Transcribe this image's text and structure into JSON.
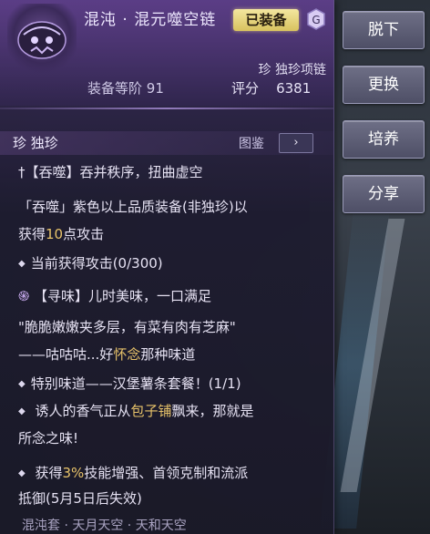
{
  "item": {
    "name": "混沌 · 混元噬空链",
    "status_badge": "已装备",
    "subtype": "珍 独珍项链",
    "level_label": "装备等阶",
    "level_value": "91",
    "score_label": "评分",
    "score_value": "6381"
  },
  "quality": {
    "label": "珍 独珍",
    "codex_label": "图鉴",
    "codex_button": "›"
  },
  "effects": [
    {
      "id": "e1",
      "text": "†【吞噬】吞并秩序，扭曲虚空"
    },
    {
      "id": "e2",
      "text": "「吞噬」紫色以上品质装备(非独珍)以"
    },
    {
      "id": "e3a",
      "text": "获得"
    },
    {
      "id": "e3b",
      "text": "10"
    },
    {
      "id": "e3c",
      "text": "点攻击"
    },
    {
      "id": "e4",
      "text": "当前获得攻击(0/300)"
    },
    {
      "id": "e5",
      "text": "【寻味】儿时美味，一口满足"
    },
    {
      "id": "e6",
      "text": "\"脆脆嫩嫩夹多层，有菜有肉有芝麻\""
    },
    {
      "id": "e7a",
      "text": "——咕咕咕...好"
    },
    {
      "id": "e7b",
      "text": "怀念"
    },
    {
      "id": "e7c",
      "text": "那种味道"
    },
    {
      "id": "e8",
      "text": "特别味道——汉堡薯条套餐！(1/1)"
    },
    {
      "id": "e9a",
      "text": "诱人的香气正从"
    },
    {
      "id": "e9b",
      "text": "包子铺"
    },
    {
      "id": "e9c",
      "text": "飘来，那就是"
    },
    {
      "id": "e10",
      "text": "所念之味!"
    },
    {
      "id": "e11a",
      "text": "获得"
    },
    {
      "id": "e11b",
      "text": "3%"
    },
    {
      "id": "e11c",
      "text": "技能增强、首领克制和流派"
    },
    {
      "id": "e12",
      "text": "抵御(5月5日后失效)"
    }
  ],
  "footer": "混沌套 · 天月天空 · 天和天空",
  "actions": {
    "unequip": "脱下",
    "replace": "更换",
    "cultivate": "培养",
    "share": "分享"
  },
  "colors": {
    "accent_purple": "#d7b7ff",
    "accent_gold": "#e8c36a",
    "badge": "#e8d77a"
  }
}
